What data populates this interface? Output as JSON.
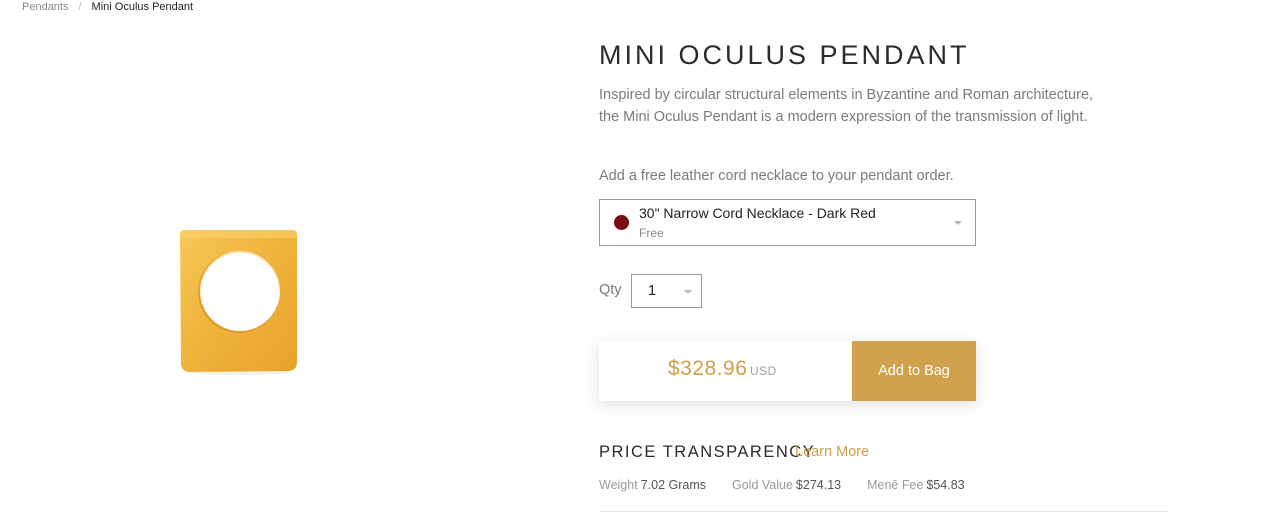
{
  "breadcrumb": {
    "parent": "Pendants",
    "separator": "/",
    "current": "Mini Oculus Pendant"
  },
  "product": {
    "title": "MINI OCULUS PENDANT",
    "description": "Inspired by circular structural elements in Byzantine and Roman architecture, the Mini Oculus Pendant is a modern expression of the transmission of light.",
    "image_icon": "gold-square-pendant-with-round-hole"
  },
  "cord": {
    "note": "Add a free leather cord necklace to your pendant order.",
    "selected_name": "30\" Narrow Cord Necklace - Dark Red",
    "selected_price": "Free",
    "swatch_color": "#7a0b10"
  },
  "quantity": {
    "label": "Qty",
    "value": "1"
  },
  "purchase": {
    "price": "$328.96",
    "currency": "USD",
    "add_label": "Add to Bag"
  },
  "price_transparency": {
    "heading": "PRICE TRANSPARENCY",
    "learn_more": "Learn More",
    "weight_label": "Weight",
    "weight_value": "7.02 Grams",
    "gold_label": "Gold Value",
    "gold_value": "$274.13",
    "fee_label": "Menē Fee",
    "fee_value": "$54.83"
  },
  "colors": {
    "accent_gold": "#d1a24d",
    "price_gold": "#cf9f4a"
  }
}
